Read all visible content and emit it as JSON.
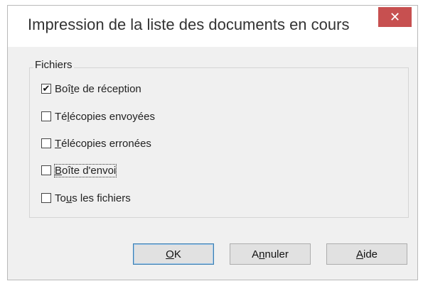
{
  "dialog": {
    "title": "Impression de la liste des documents en cours",
    "close_label": "✕"
  },
  "group": {
    "label": "Fichiers",
    "items": [
      {
        "before": "Boî",
        "mnemonic": "t",
        "after": "e de réception",
        "checked": true
      },
      {
        "before": "Té",
        "mnemonic": "l",
        "after": "écopies envoyées",
        "checked": false
      },
      {
        "before": "",
        "mnemonic": "T",
        "after": "élécopies erronées",
        "checked": false
      },
      {
        "before": "",
        "mnemonic": "B",
        "after": "oîte d'envoi",
        "checked": false
      },
      {
        "before": "To",
        "mnemonic": "u",
        "after": "s les fichiers",
        "checked": false
      }
    ]
  },
  "buttons": {
    "ok": {
      "before": "",
      "mnemonic": "O",
      "after": "K"
    },
    "cancel": {
      "before": "A",
      "mnemonic": "n",
      "after": "nuler"
    },
    "help": {
      "before": "",
      "mnemonic": "A",
      "after": "ide"
    }
  },
  "colors": {
    "close_button": "#c75050",
    "dialog_body": "#f0f0f0",
    "default_button_border": "#3c7fb1"
  }
}
